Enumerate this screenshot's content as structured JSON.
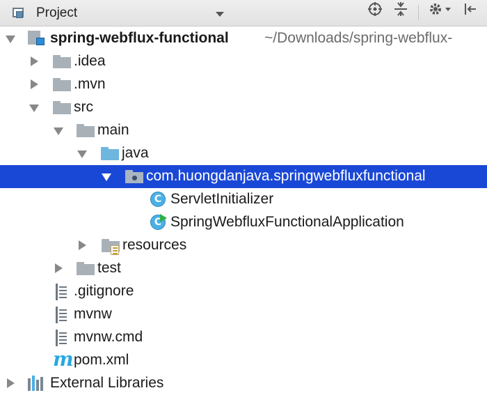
{
  "toolbar": {
    "title": "Project",
    "icons": [
      "project-view-icon",
      "dropdown-arrow-icon",
      "locate-icon",
      "collapse-all-icon",
      "settings-gear-icon",
      "hide-panel-icon"
    ]
  },
  "tree": {
    "root_name": "spring-webflux-functional",
    "root_path": "~/Downloads/spring-webflux-",
    "idea": ".idea",
    "mvn": ".mvn",
    "src": "src",
    "main": "main",
    "java": "java",
    "package": "com.huongdanjava.springwebfluxfunctional",
    "class1_icon_letter": "C",
    "class1": "ServletInitializer",
    "class2_icon_letter": "C",
    "class2": "SpringWebfluxFunctionalApplication",
    "resources": "resources",
    "test": "test",
    "gitignore": ".gitignore",
    "mvnw": "mvnw",
    "mvnw_cmd": "mvnw.cmd",
    "maven_icon_letter": "m",
    "pom": "pom.xml",
    "external": "External Libraries"
  },
  "colors": {
    "selection": "#1a48d6",
    "folder_gray": "#a9b1b8",
    "folder_blue": "#6fb6de",
    "class_icon": "#4ab0e6",
    "maven": "#28a8e0"
  }
}
